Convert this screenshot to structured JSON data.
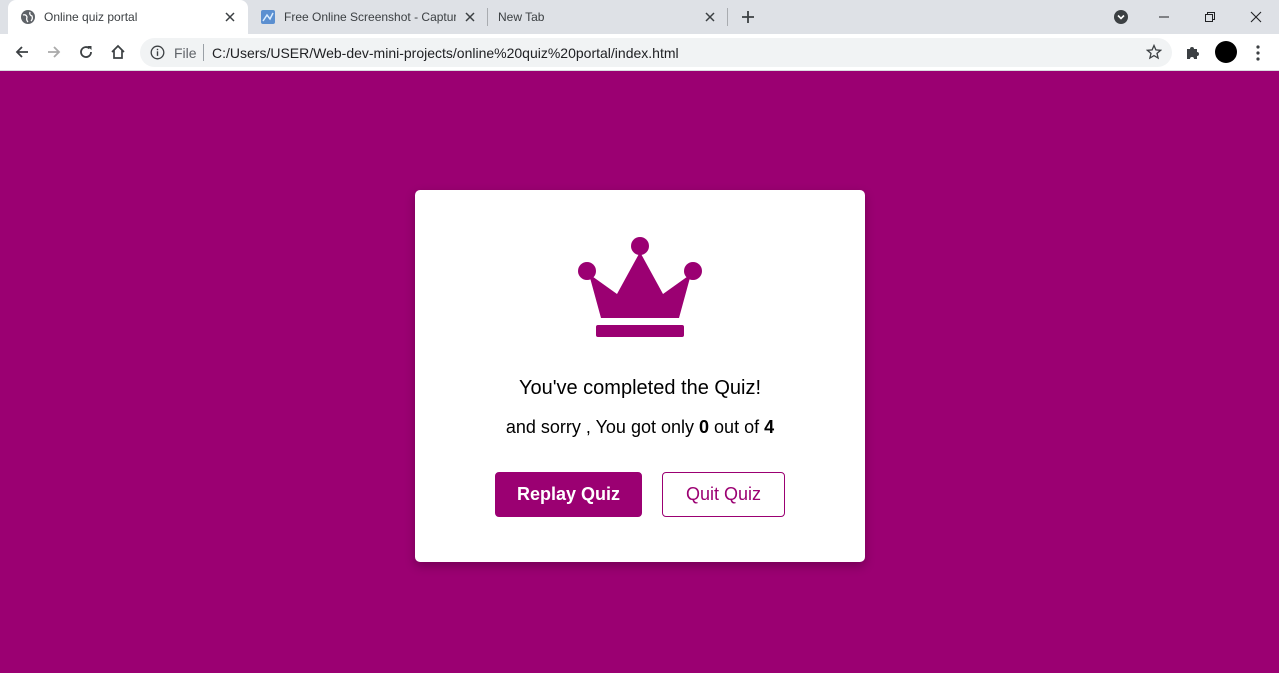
{
  "browser": {
    "tabs": [
      {
        "title": "Online quiz portal",
        "icon": "globe-icon",
        "active": true
      },
      {
        "title": "Free Online Screenshot - Capture",
        "icon": "screenshot-site-icon",
        "active": false
      },
      {
        "title": "New Tab",
        "icon": "",
        "active": false
      }
    ],
    "omnibox": {
      "scheme_label": "File",
      "url": "C:/Users/USER/Web-dev-mini-projects/online%20quiz%20portal/index.html"
    }
  },
  "colors": {
    "accent": "#9b0072",
    "card": "#ffffff",
    "tabstrip": "#dee1e6"
  },
  "result": {
    "icon": "crown-icon",
    "completed_text": "You've completed the Quiz!",
    "score_prefix": "and sorry , You got only",
    "score_value": "0",
    "score_middle": "out of",
    "score_total": "4",
    "replay_label": "Replay Quiz",
    "quit_label": "Quit Quiz"
  }
}
